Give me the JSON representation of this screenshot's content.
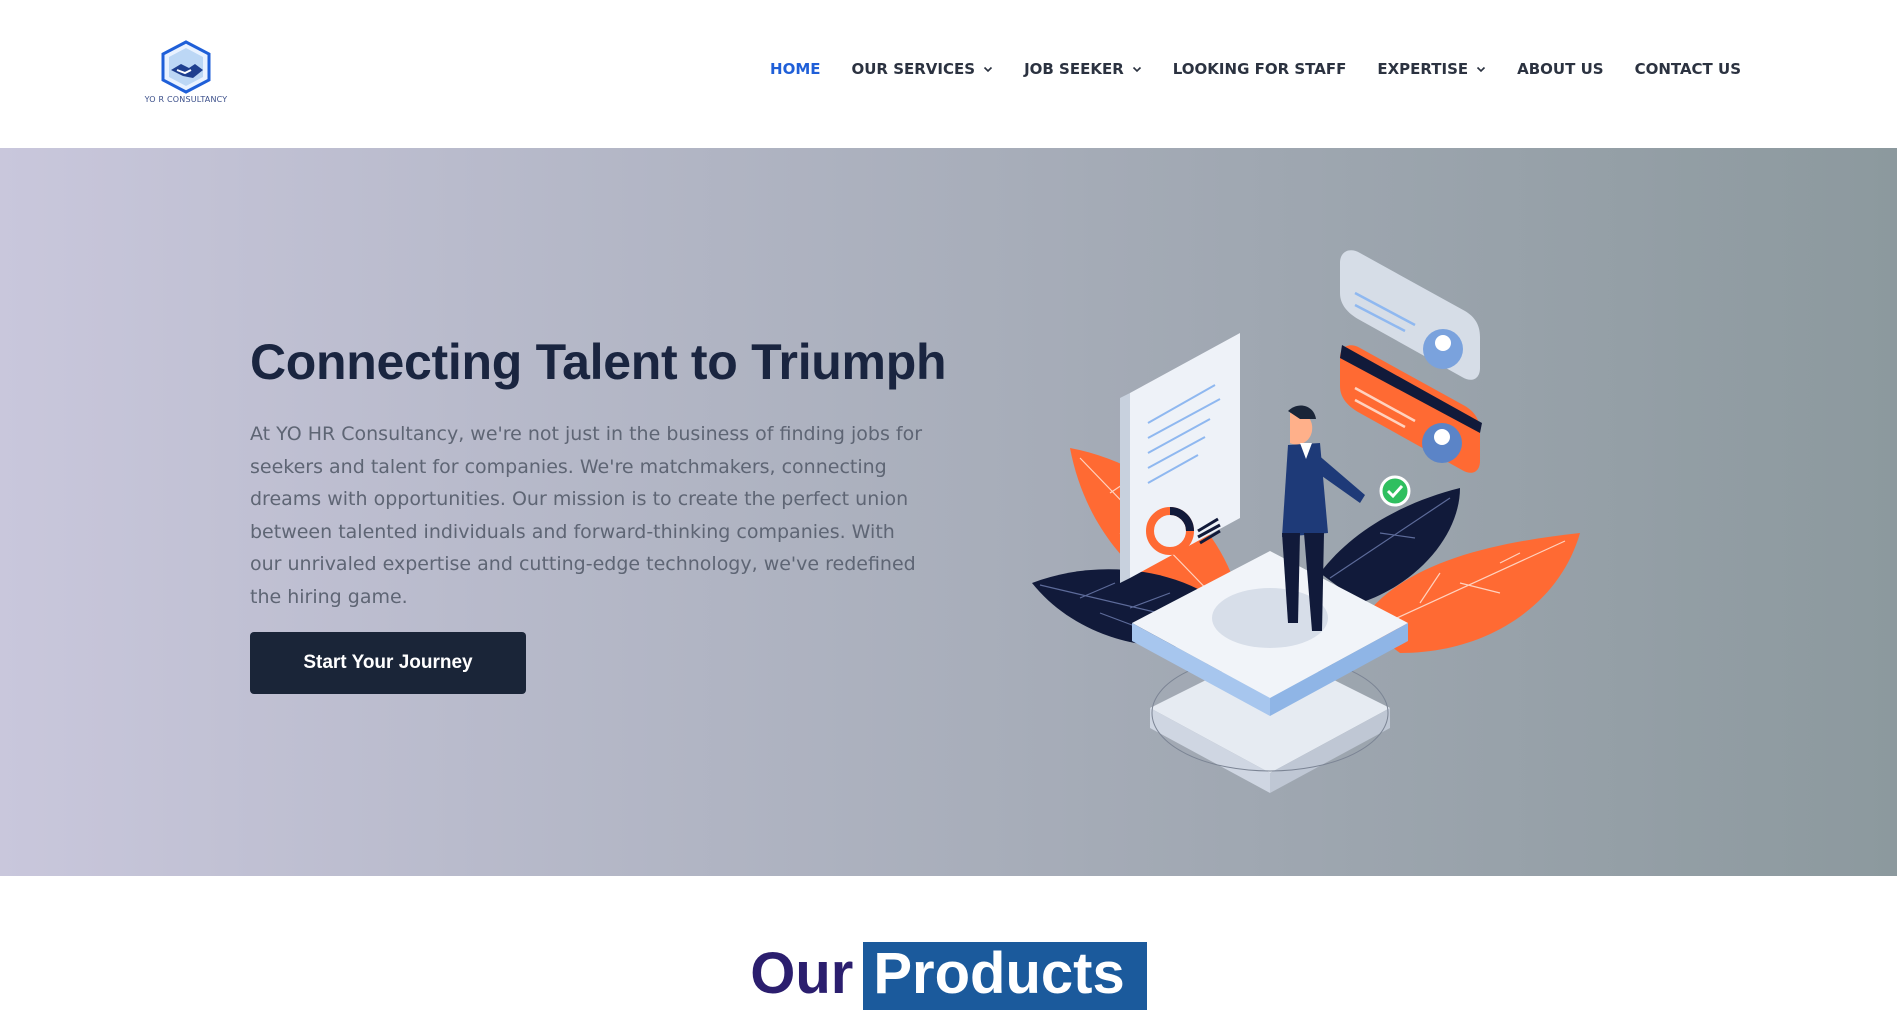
{
  "header": {
    "logo_text": "YO R CONSULTANCY",
    "nav": [
      {
        "label": "HOME",
        "active": true,
        "has_dropdown": false
      },
      {
        "label": "OUR SERVICES",
        "active": false,
        "has_dropdown": true
      },
      {
        "label": "JOB SEEKER",
        "active": false,
        "has_dropdown": true
      },
      {
        "label": "LOOKING FOR STAFF",
        "active": false,
        "has_dropdown": false
      },
      {
        "label": "EXPERTISE",
        "active": false,
        "has_dropdown": true
      },
      {
        "label": "ABOUT US",
        "active": false,
        "has_dropdown": false
      },
      {
        "label": "CONTACT US",
        "active": false,
        "has_dropdown": false
      }
    ]
  },
  "hero": {
    "title": "Connecting Talent to Triumph",
    "text": "At YO HR Consultancy, we're not just in the business of finding jobs for seekers and talent for companies. We're matchmakers, connecting dreams with opportunities. Our mission is to create the perfect union between talented individuals and forward-thinking companies. With our unrivaled expertise and cutting-edge technology, we've redefined the hiring game.",
    "cta_label": "Start Your Journey"
  },
  "products": {
    "word1": "Our",
    "word2": "Products"
  },
  "colors": {
    "nav_active": "#1f5fd8",
    "nav_text": "#2b3240",
    "cta_bg": "#1a2538",
    "title_text": "#1a2540",
    "products_highlight": "#1b5a9c",
    "accent_orange": "#ff6a33"
  },
  "icons": {
    "dropdown": "chevron-down-icon",
    "logo": "handshake-hexagon-logo"
  }
}
